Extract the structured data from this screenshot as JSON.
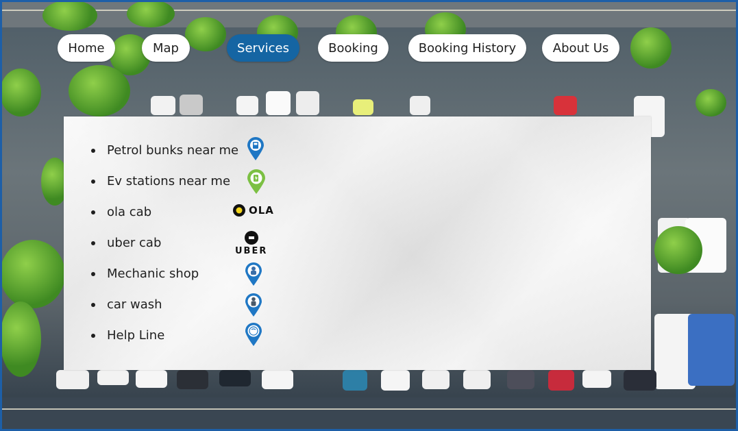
{
  "nav": {
    "items": [
      {
        "label": "Home",
        "active": false
      },
      {
        "label": "Map",
        "active": false
      },
      {
        "label": "Services",
        "active": true
      },
      {
        "label": "Booking",
        "active": false
      },
      {
        "label": "Booking History",
        "active": false
      },
      {
        "label": "About Us",
        "active": false
      }
    ]
  },
  "services": {
    "items": [
      {
        "label": "Petrol bunks near me",
        "icon": "petrol-pump-pin-icon"
      },
      {
        "label": "Ev stations near me",
        "icon": "ev-station-pin-icon"
      },
      {
        "label": "ola cab",
        "icon": "ola-logo"
      },
      {
        "label": "uber cab",
        "icon": "uber-logo"
      },
      {
        "label": "Mechanic shop",
        "icon": "mechanic-pin-icon"
      },
      {
        "label": "car wash",
        "icon": "car-wash-pin-icon"
      },
      {
        "label": "Help Line",
        "icon": "helpline-24-7-pin-icon"
      }
    ],
    "logos": {
      "ola": "OLA",
      "uber": "UBER"
    }
  },
  "colors": {
    "accent": "#1565a3",
    "pin_blue": "#1f77c4",
    "pin_green": "#7cc043",
    "frame": "#1d5fa8"
  }
}
